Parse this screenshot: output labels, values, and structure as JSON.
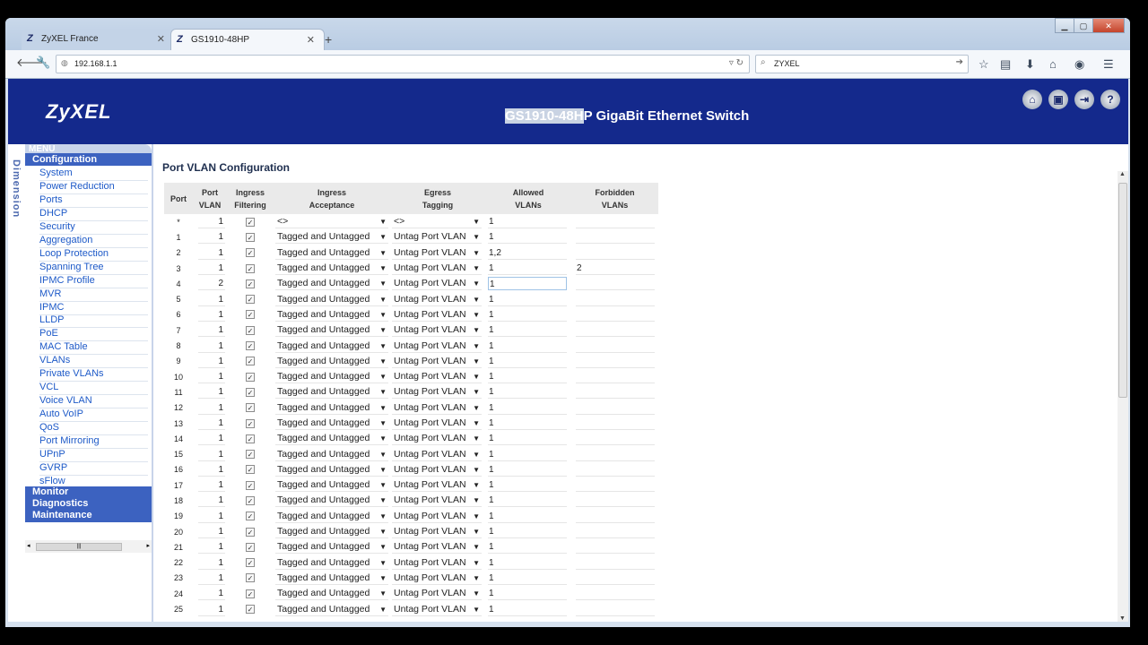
{
  "browser": {
    "tabs": [
      {
        "label": "ZyXEL France",
        "icon": "Z"
      },
      {
        "label": "GS1910-48HP",
        "icon": "Z"
      }
    ],
    "url": "192.168.1.1",
    "search_value": "ZYXEL",
    "new_tab": "+"
  },
  "header": {
    "logo": "ZyXEL",
    "title_highlight": "GS1910-48H",
    "title_rest": "P GigaBit Ethernet Switch"
  },
  "sidebar": {
    "vertical_text": "Dimension",
    "menu_header": "MENU",
    "config_label": "Configuration",
    "items": [
      "System",
      "Power Reduction",
      "Ports",
      "DHCP",
      "Security",
      "Aggregation",
      "Loop Protection",
      "Spanning Tree",
      "IPMC Profile",
      "MVR",
      "IPMC",
      "LLDP",
      "PoE",
      "MAC Table",
      "VLANs",
      "Private VLANs",
      "VCL",
      "Voice VLAN",
      "Auto VoIP",
      "QoS",
      "Port Mirroring",
      "UPnP",
      "GVRP",
      "sFlow"
    ],
    "sections": [
      "Monitor",
      "Diagnostics",
      "Maintenance"
    ]
  },
  "content": {
    "title": "Port VLAN Configuration",
    "columns": [
      "Port",
      "Port\nVLAN",
      "Ingress\nFiltering",
      "Ingress\nAcceptance",
      "Egress\nTagging",
      "Allowed\nVLANs",
      "Forbidden\nVLANs"
    ],
    "rows": [
      {
        "port": "*",
        "pvid": "1",
        "acc": "<>",
        "eg": "<>",
        "allowed": "1",
        "forbidden": ""
      },
      {
        "port": "1",
        "pvid": "1",
        "acc": "Tagged and Untagged",
        "eg": "Untag Port VLAN",
        "allowed": "1",
        "forbidden": ""
      },
      {
        "port": "2",
        "pvid": "1",
        "acc": "Tagged and Untagged",
        "eg": "Untag Port VLAN",
        "allowed": "1,2",
        "forbidden": ""
      },
      {
        "port": "3",
        "pvid": "1",
        "acc": "Tagged and Untagged",
        "eg": "Untag Port VLAN",
        "allowed": "1",
        "forbidden": "2"
      },
      {
        "port": "4",
        "pvid": "2",
        "acc": "Tagged and Untagged",
        "eg": "Untag Port VLAN",
        "allowed": "1",
        "forbidden": ""
      },
      {
        "port": "5",
        "pvid": "1",
        "acc": "Tagged and Untagged",
        "eg": "Untag Port VLAN",
        "allowed": "1",
        "forbidden": ""
      },
      {
        "port": "6",
        "pvid": "1",
        "acc": "Tagged and Untagged",
        "eg": "Untag Port VLAN",
        "allowed": "1",
        "forbidden": ""
      },
      {
        "port": "7",
        "pvid": "1",
        "acc": "Tagged and Untagged",
        "eg": "Untag Port VLAN",
        "allowed": "1",
        "forbidden": ""
      },
      {
        "port": "8",
        "pvid": "1",
        "acc": "Tagged and Untagged",
        "eg": "Untag Port VLAN",
        "allowed": "1",
        "forbidden": ""
      },
      {
        "port": "9",
        "pvid": "1",
        "acc": "Tagged and Untagged",
        "eg": "Untag Port VLAN",
        "allowed": "1",
        "forbidden": ""
      },
      {
        "port": "10",
        "pvid": "1",
        "acc": "Tagged and Untagged",
        "eg": "Untag Port VLAN",
        "allowed": "1",
        "forbidden": ""
      },
      {
        "port": "11",
        "pvid": "1",
        "acc": "Tagged and Untagged",
        "eg": "Untag Port VLAN",
        "allowed": "1",
        "forbidden": ""
      },
      {
        "port": "12",
        "pvid": "1",
        "acc": "Tagged and Untagged",
        "eg": "Untag Port VLAN",
        "allowed": "1",
        "forbidden": ""
      },
      {
        "port": "13",
        "pvid": "1",
        "acc": "Tagged and Untagged",
        "eg": "Untag Port VLAN",
        "allowed": "1",
        "forbidden": ""
      },
      {
        "port": "14",
        "pvid": "1",
        "acc": "Tagged and Untagged",
        "eg": "Untag Port VLAN",
        "allowed": "1",
        "forbidden": ""
      },
      {
        "port": "15",
        "pvid": "1",
        "acc": "Tagged and Untagged",
        "eg": "Untag Port VLAN",
        "allowed": "1",
        "forbidden": ""
      },
      {
        "port": "16",
        "pvid": "1",
        "acc": "Tagged and Untagged",
        "eg": "Untag Port VLAN",
        "allowed": "1",
        "forbidden": ""
      },
      {
        "port": "17",
        "pvid": "1",
        "acc": "Tagged and Untagged",
        "eg": "Untag Port VLAN",
        "allowed": "1",
        "forbidden": ""
      },
      {
        "port": "18",
        "pvid": "1",
        "acc": "Tagged and Untagged",
        "eg": "Untag Port VLAN",
        "allowed": "1",
        "forbidden": ""
      },
      {
        "port": "19",
        "pvid": "1",
        "acc": "Tagged and Untagged",
        "eg": "Untag Port VLAN",
        "allowed": "1",
        "forbidden": ""
      },
      {
        "port": "20",
        "pvid": "1",
        "acc": "Tagged and Untagged",
        "eg": "Untag Port VLAN",
        "allowed": "1",
        "forbidden": ""
      },
      {
        "port": "21",
        "pvid": "1",
        "acc": "Tagged and Untagged",
        "eg": "Untag Port VLAN",
        "allowed": "1",
        "forbidden": ""
      },
      {
        "port": "22",
        "pvid": "1",
        "acc": "Tagged and Untagged",
        "eg": "Untag Port VLAN",
        "allowed": "1",
        "forbidden": ""
      },
      {
        "port": "23",
        "pvid": "1",
        "acc": "Tagged and Untagged",
        "eg": "Untag Port VLAN",
        "allowed": "1",
        "forbidden": ""
      },
      {
        "port": "24",
        "pvid": "1",
        "acc": "Tagged and Untagged",
        "eg": "Untag Port VLAN",
        "allowed": "1",
        "forbidden": ""
      },
      {
        "port": "25",
        "pvid": "1",
        "acc": "Tagged and Untagged",
        "eg": "Untag Port VLAN",
        "allowed": "1",
        "forbidden": ""
      }
    ]
  },
  "icons": {
    "home": "home-icon",
    "save": "save-icon",
    "logout": "logout-icon",
    "help": "help-icon"
  }
}
